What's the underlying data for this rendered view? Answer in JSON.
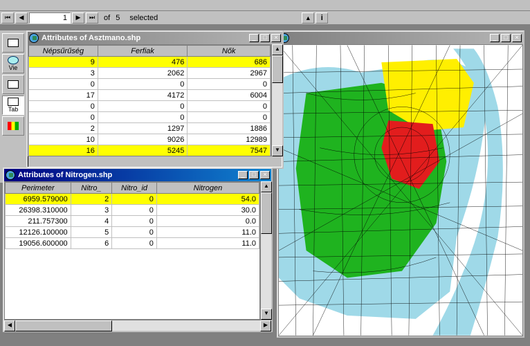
{
  "toolbar": {
    "record_current": "1",
    "record_of": "of",
    "record_total": "5",
    "selected_label": "selected"
  },
  "sidebar": {
    "items": [
      {
        "label": "",
        "icon": "doc"
      },
      {
        "label": "Vie",
        "icon": "globe"
      },
      {
        "label": "",
        "icon": "table"
      },
      {
        "label": "Tab",
        "icon": "table-sel"
      },
      {
        "label": "",
        "icon": "chart"
      }
    ]
  },
  "windows": {
    "asztmano": {
      "title": "Attributes of Asztmano.shp",
      "columns": [
        "Népsűrűség",
        "Ferfiak",
        "Nők"
      ],
      "rows": [
        {
          "vals": [
            "9",
            "476",
            "686"
          ],
          "hl": true
        },
        {
          "vals": [
            "3",
            "2062",
            "2967"
          ],
          "hl": false
        },
        {
          "vals": [
            "0",
            "0",
            "0"
          ],
          "hl": false
        },
        {
          "vals": [
            "17",
            "4172",
            "6004"
          ],
          "hl": false
        },
        {
          "vals": [
            "0",
            "0",
            "0"
          ],
          "hl": false
        },
        {
          "vals": [
            "0",
            "0",
            "0"
          ],
          "hl": false
        },
        {
          "vals": [
            "2",
            "1297",
            "1886"
          ],
          "hl": false
        },
        {
          "vals": [
            "10",
            "9026",
            "12989"
          ],
          "hl": false
        },
        {
          "vals": [
            "16",
            "5245",
            "7547"
          ],
          "hl": true
        }
      ]
    },
    "nitrogen": {
      "title": "Attributes of Nitrogen.shp",
      "columns": [
        "Perimeter",
        "Nitro_",
        "Nitro_id",
        "Nitrogen"
      ],
      "rows": [
        {
          "vals": [
            "6959.579000",
            "2",
            "0",
            "54.0"
          ],
          "hl": true
        },
        {
          "vals": [
            "26398.310000",
            "3",
            "0",
            "30.0"
          ],
          "hl": false
        },
        {
          "vals": [
            "211.757300",
            "4",
            "0",
            "0.0"
          ],
          "hl": false
        },
        {
          "vals": [
            "12126.100000",
            "5",
            "0",
            "11.0"
          ],
          "hl": false
        },
        {
          "vals": [
            "19056.600000",
            "6",
            "0",
            "11.0"
          ],
          "hl": false
        }
      ]
    },
    "map": {
      "title": ""
    }
  },
  "colors": {
    "highlight": "#ffff00",
    "map_water": "#9fd9e8",
    "map_green": "#1fb31f",
    "map_yellow": "#ffef00",
    "map_red": "#e21d1d"
  }
}
